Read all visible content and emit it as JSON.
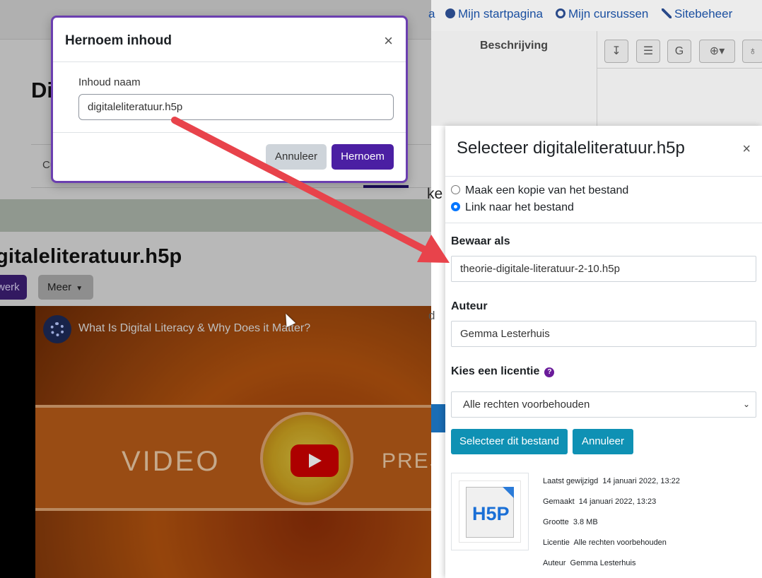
{
  "background_page": {
    "heading_truncated": "Di",
    "tab_truncated": "Cu",
    "content_title": "gitaleliteratuur.h5p",
    "edit_button_truncated": "werk",
    "more_button": "Meer",
    "fragment_ke": "ke",
    "fragment_d": "d"
  },
  "video": {
    "title": "What Is Digital Literacy & Why Does it Matter?",
    "word_left": "VIDEO",
    "word_right": "PRES"
  },
  "top_nav": {
    "item_a": "a",
    "item_dashboard": "Mijn startpagina",
    "item_courses": "Mijn cursussen",
    "item_admin": "Sitebeheer"
  },
  "table_header": {
    "description": "Beschrijving"
  },
  "toolbar": {
    "g_label": "G"
  },
  "rename_modal": {
    "title": "Hernoem inhoud",
    "field_label": "Inhoud naam",
    "field_value": "digitaleliteratuur.h5p",
    "cancel_label": "Annuleer",
    "rename_label": "Hernoem"
  },
  "file_picker": {
    "title": "Selecteer digitaleliteratuur.h5p",
    "option_copy": "Maak een kopie van het bestand",
    "option_link": "Link naar het bestand",
    "selected_option": "link",
    "save_as_label": "Bewaar als",
    "save_as_value": "theorie-digitale-literatuur-2-10.h5p",
    "author_label": "Auteur",
    "author_value": "Gemma Lesterhuis",
    "license_label": "Kies een licentie",
    "license_value": "Alle rechten voorbehouden",
    "select_button": "Selecteer dit bestand",
    "cancel_button": "Annuleer",
    "thumbnail_label": "H5P",
    "meta": {
      "modified_label": "Laatst gewijzigd",
      "modified_value": "14 januari 2022, 13:22",
      "created_label": "Gemaakt",
      "created_value": "14 januari 2022, 13:23",
      "size_label": "Grootte",
      "size_value": "3.8 MB",
      "license_label": "Licentie",
      "license_value": "Alle rechten voorbehouden",
      "author_label": "Auteur",
      "author_value": "Gemma Lesterhuis"
    }
  },
  "colors": {
    "primary_purple": "#4b1fa3",
    "modal_border": "#6b3fb0",
    "picker_button": "#0f91b4",
    "annotation_arrow": "#e8434b",
    "nav_link": "#1a4fa0"
  },
  "icons": {
    "dashboard": "dashboard-icon",
    "courses": "target-icon",
    "admin": "wrench-icon",
    "close": "close-icon",
    "help": "help-icon",
    "license_caret": "chevron-down-icon"
  }
}
